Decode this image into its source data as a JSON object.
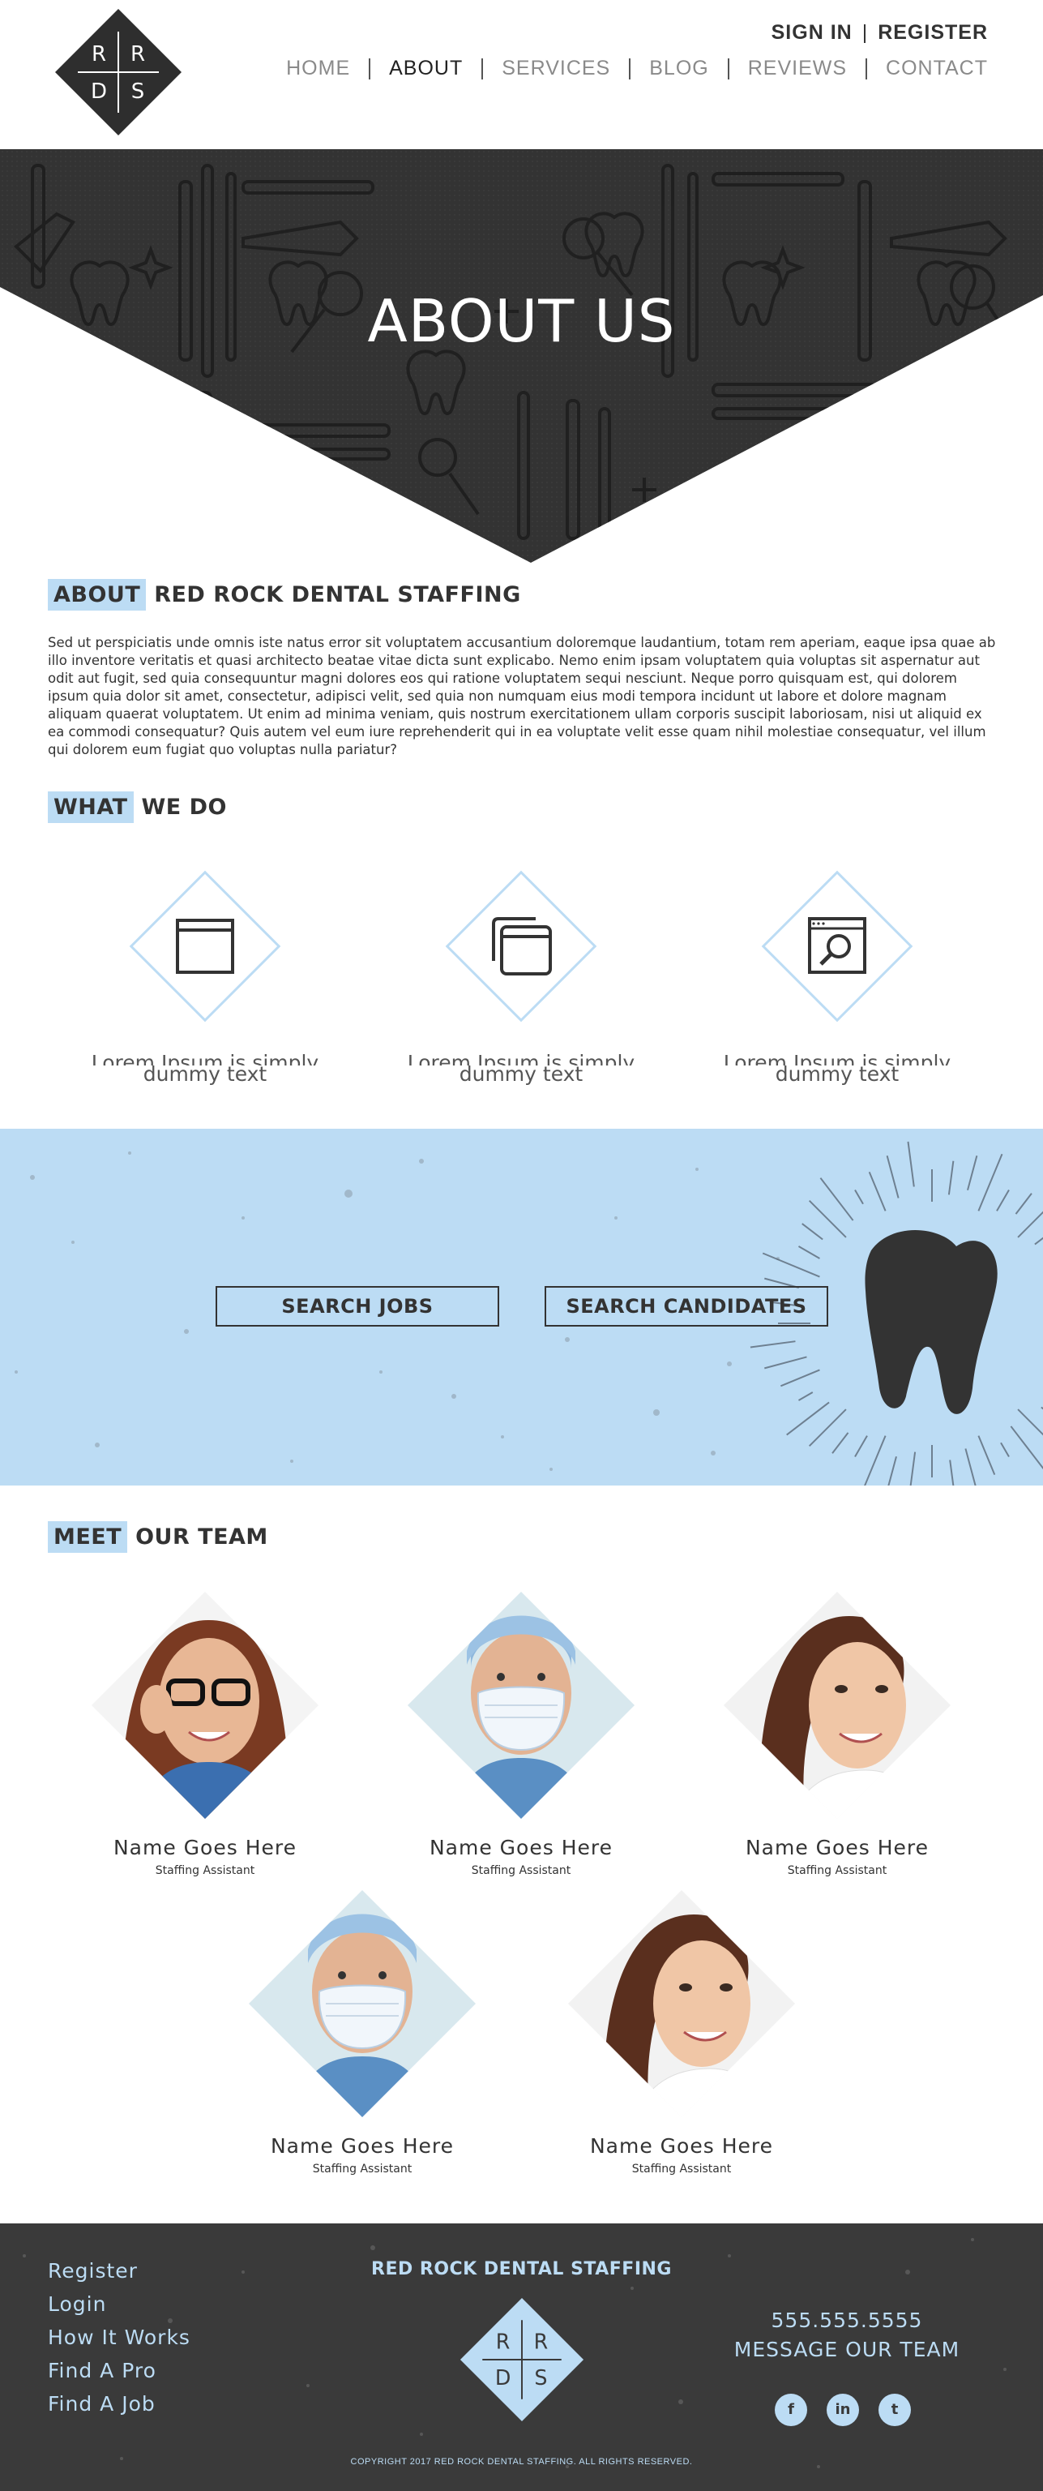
{
  "brand": {
    "logo_letters": [
      "R",
      "R",
      "D",
      "S"
    ],
    "accent_color": "#bcdcf4",
    "dark_color": "#3a3a3a"
  },
  "header": {
    "sign_in": "SIGN IN",
    "register": "REGISTER",
    "auth_separator": "|",
    "nav": [
      "HOME",
      "ABOUT",
      "SERVICES",
      "BLOG",
      "REVIEWS",
      "CONTACT"
    ],
    "active_nav": "ABOUT"
  },
  "hero": {
    "title": "ABOUT US"
  },
  "about": {
    "heading_highlight": "ABOUT",
    "heading_rest": "RED ROCK DENTAL STAFFING",
    "body": "Sed ut perspiciatis unde omnis iste natus error sit voluptatem accusantium doloremque laudantium, totam rem aperiam, eaque ipsa quae ab illo inventore veritatis et quasi architecto beatae vitae dicta sunt explicabo. Nemo enim ipsam voluptatem quia voluptas sit aspernatur aut odit aut fugit, sed quia consequuntur magni dolores eos qui ratione voluptatem sequi nesciunt. Neque porro quisquam est, qui dolorem ipsum quia dolor sit amet, consectetur, adipisci velit, sed quia non numquam eius modi tempora incidunt ut labore et dolore magnam aliquam quaerat voluptatem. Ut enim ad minima veniam, quis nostrum exercitationem ullam corporis suscipit laboriosam, nisi ut aliquid ex ea commodi consequatur? Quis autem vel eum iure reprehenderit qui in ea voluptate velit esse quam nihil molestiae consequatur, vel illum qui dolorem eum fugiat quo voluptas nulla pariatur?"
  },
  "what_we_do": {
    "heading_highlight": "WHAT",
    "heading_rest": "WE DO",
    "items": [
      {
        "icon": "window-icon",
        "line1": "Lorem Ipsum is simply",
        "line2": "dummy text"
      },
      {
        "icon": "stacked-windows-icon",
        "line1": "Lorem Ipsum is simply",
        "line2": "dummy text"
      },
      {
        "icon": "window-search-icon",
        "line1": "Lorem Ipsum is simply",
        "line2": "dummy text"
      }
    ]
  },
  "banner": {
    "search_jobs": "SEARCH JOBS",
    "search_candidates": "SEARCH CANDIDATES"
  },
  "team": {
    "heading_highlight": "MEET",
    "heading_rest": "OUR TEAM",
    "members": [
      {
        "name": "Name Goes Here",
        "role": "Staffing Assistant",
        "photo": "woman-glasses"
      },
      {
        "name": "Name Goes Here",
        "role": "Staffing Assistant",
        "photo": "surgeon-mask"
      },
      {
        "name": "Name Goes Here",
        "role": "Staffing Assistant",
        "photo": "woman-smile"
      },
      {
        "name": "Name Goes Here",
        "role": "Staffing Assistant",
        "photo": "surgeon-mask"
      },
      {
        "name": "Name Goes Here",
        "role": "Staffing Assistant",
        "photo": "woman-smile"
      }
    ]
  },
  "footer": {
    "links": [
      "Register",
      "Login",
      "How It Works",
      "Find A Pro",
      "Find A Job"
    ],
    "title": "RED ROCK DENTAL STAFFING",
    "phone": "555.555.5555",
    "message": "MESSAGE OUR TEAM",
    "social": [
      {
        "icon": "facebook-icon",
        "glyph": "f"
      },
      {
        "icon": "linkedin-icon",
        "glyph": "in"
      },
      {
        "icon": "twitter-icon",
        "glyph": "t"
      }
    ],
    "copyright": "COPYRIGHT 2017 RED ROCK DENTAL STAFFING. ALL RIGHTS RESERVED."
  }
}
